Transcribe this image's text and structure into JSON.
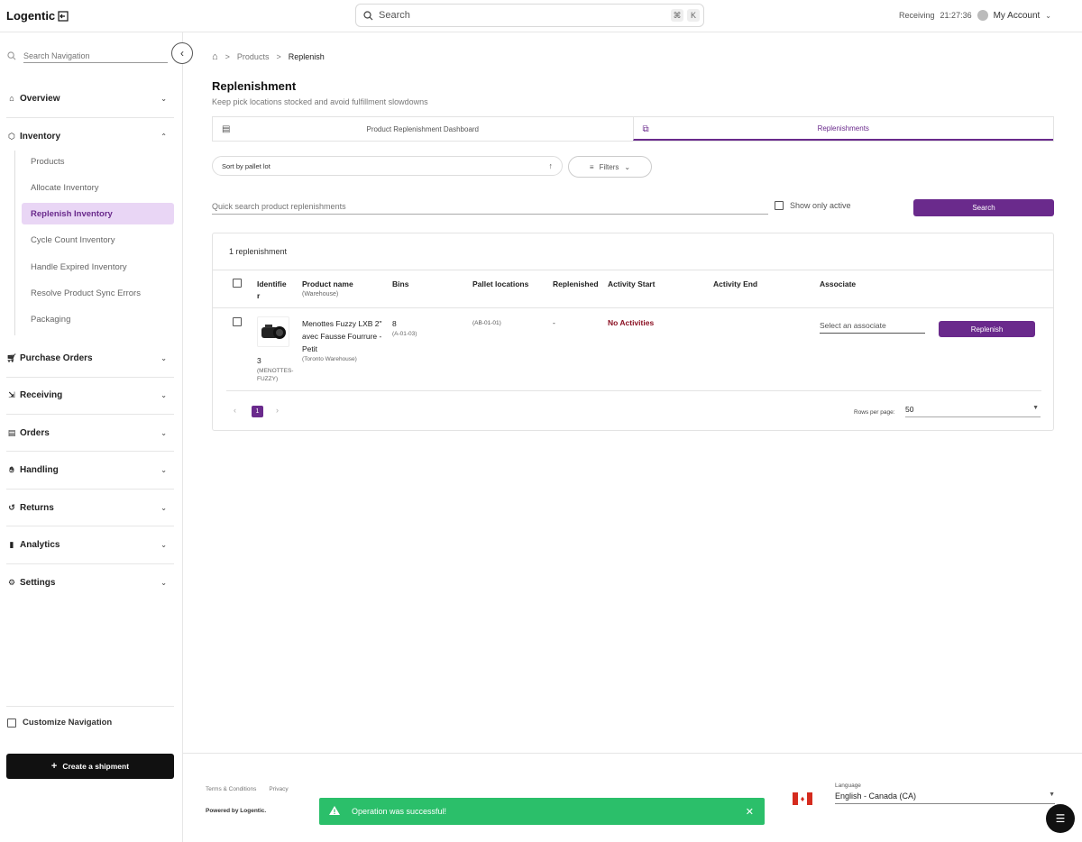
{
  "topbar": {
    "logo": "Logentic",
    "search_placeholder": "Search",
    "kbd1": "⌘",
    "kbd2": "K",
    "receiving_label": "Receiving",
    "receiving_time": "21:27:36",
    "account_label": "My Account"
  },
  "sidebar": {
    "search_placeholder": "Search Navigation",
    "sections": {
      "overview": "Overview",
      "inventory": "Inventory",
      "purchase_orders": "Purchase Orders",
      "receiving": "Receiving",
      "orders": "Orders",
      "handling": "Handling",
      "returns": "Returns",
      "analytics": "Analytics",
      "settings": "Settings"
    },
    "inventory_items": {
      "products": "Products",
      "allocate": "Allocate Inventory",
      "replenish": "Replenish Inventory",
      "cycle_count": "Cycle Count Inventory",
      "expired": "Handle Expired Inventory",
      "sync_errors": "Resolve Product Sync Errors",
      "packaging": "Packaging"
    },
    "customize_label": "Customize Navigation",
    "create_shipment": "Create a shipment"
  },
  "breadcrumb": {
    "products": "Products",
    "current": "Replenish"
  },
  "page": {
    "title": "Replenishment",
    "subtitle": "Keep pick locations stocked and avoid fulfillment slowdowns"
  },
  "tabs": {
    "dashboard": "Product Replenishment Dashboard",
    "replenishments": "Replenishments"
  },
  "controls": {
    "sort_label": "Sort by pallet lot",
    "filters_label": "Filters",
    "quick_search_placeholder": "Quick search product replenishments",
    "show_active_label": "Show only active",
    "search_button": "Search"
  },
  "table": {
    "count_label": "1 replenishment",
    "headers": {
      "identifier_line1": "Identifie",
      "identifier_line2": "r",
      "product_name": "Product name",
      "product_name_sub": "(Warehouse)",
      "bins": "Bins",
      "pallet_locations": "Pallet locations",
      "replenished": "Replenished",
      "activity_start": "Activity Start",
      "activity_end": "Activity End",
      "associate": "Associate"
    },
    "row": {
      "identifier": "3",
      "identifier_sub_1": "(MENOTTES-",
      "identifier_sub_2": "FUZZY)",
      "product_line1": "Menottes Fuzzy LXB 2\"",
      "product_line2": "avec Fausse Fourrure -",
      "product_line3": "Petit",
      "warehouse": "(Toronto Warehouse)",
      "bins": "8",
      "bins_sub": "(A-01-03)",
      "pallet": "(AB-01-01)",
      "replenished": "-",
      "activity_start": "No Activities",
      "associate_placeholder": "Select an associate",
      "replenish_button": "Replenish"
    },
    "pagination": {
      "page": "1",
      "rows_per_page_label": "Rows per page:",
      "rows_per_page_value": "50"
    }
  },
  "footer": {
    "terms": "Terms & Conditions",
    "privacy": "Privacy",
    "powered": "Powered by Logentic.",
    "language_label": "Language",
    "language_value": "English - Canada (CA)"
  },
  "toast": {
    "message": "Operation was successful!"
  },
  "colors": {
    "accent": "#6a2a8c",
    "success": "#2bbf6a",
    "danger": "#8b1022"
  }
}
